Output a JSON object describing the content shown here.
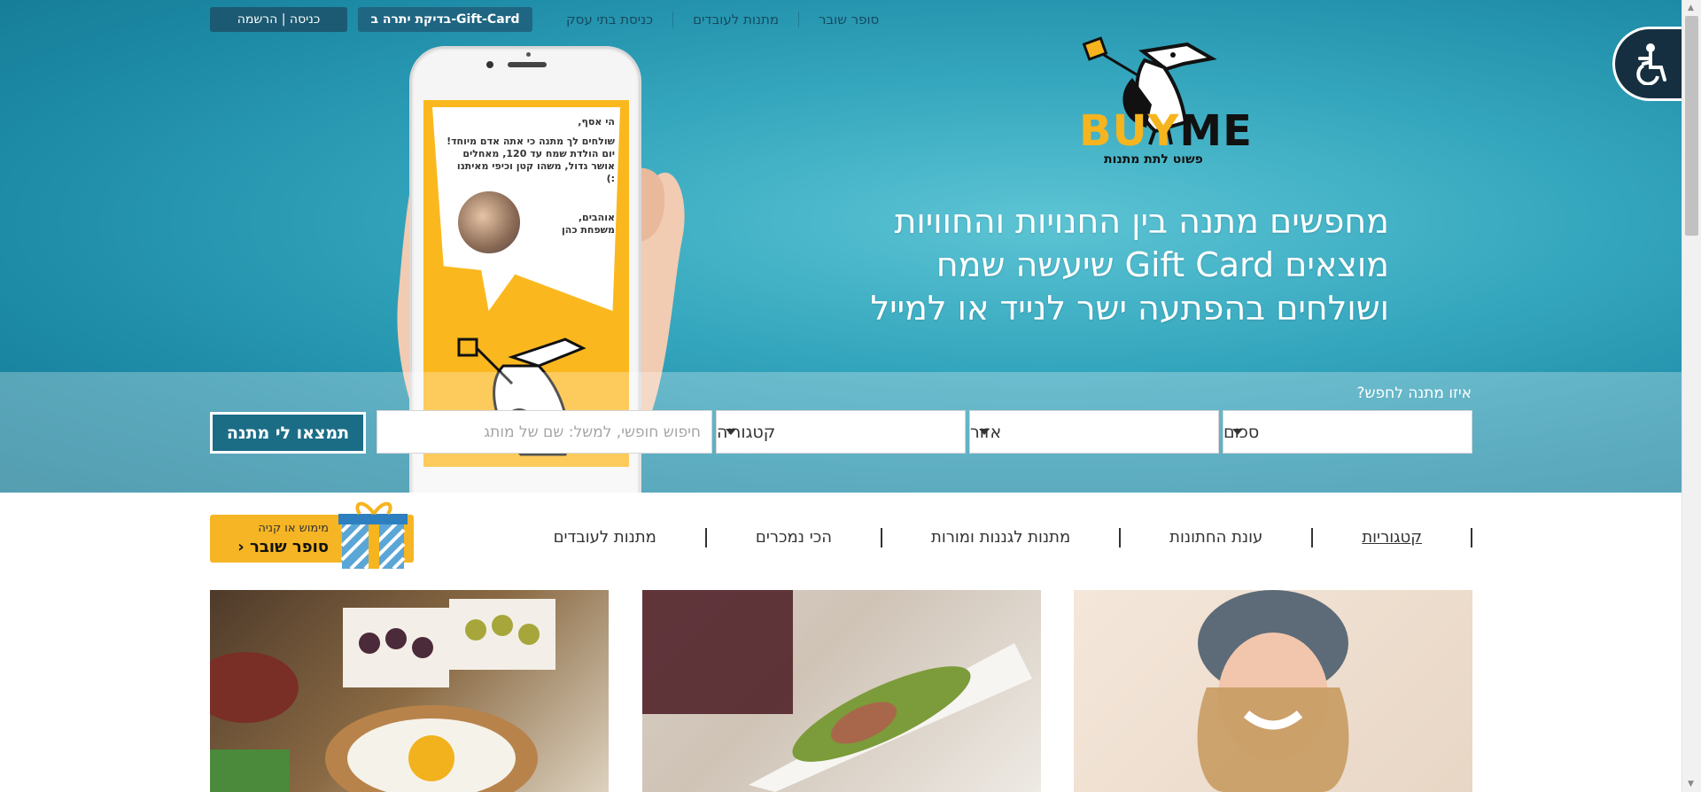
{
  "topnav": {
    "login_label": "כניסה | הרשמה",
    "balance_label": "בדיקת יתרה ב-Gift-Card",
    "links": [
      "סופר שובר",
      "מתנות לעובדים",
      "כניסת בתי עסק"
    ]
  },
  "phone_card": {
    "greeting": "הי אסף,",
    "message": "שולחים לך מתנה כי אתה אדם מיוחד! יום הולדת שמח עד 120, מאחלים אושר גדול, משהו קטן וכיפי מאיתנו :)",
    "signoff": "אוהבים,",
    "family": "משפחת כהן"
  },
  "logo": {
    "buy": "BUY",
    "me": "ME",
    "tagline": "פשוט לתת מתנות"
  },
  "headline": {
    "line1": "מחפשים מתנה בין החנויות והחוויות",
    "line2": "מוצאים Gift Card שיעשה שמח",
    "line3": "ושולחים בהפתעה ישר לנייד או למייל"
  },
  "search": {
    "label": "איזו מתנה לחפש?",
    "sum": "סכום",
    "area": "אזור",
    "category": "קטגוריה",
    "free_placeholder": "חיפוש חופשי, למשל: שם של מותג",
    "submit": "תמצאו לי מתנה"
  },
  "catnav": {
    "items": [
      "קטגוריות",
      "עונת החתונות",
      "מתנות לגננות ומורות",
      "הכי נמכרים",
      "מתנות לעובדים"
    ]
  },
  "voucher": {
    "small": "מימוש או קניה",
    "big": "סופר שובר"
  },
  "colors": {
    "hero": "#2497b1",
    "dark_button": "#1b5a72",
    "accent": "#f5b524"
  }
}
